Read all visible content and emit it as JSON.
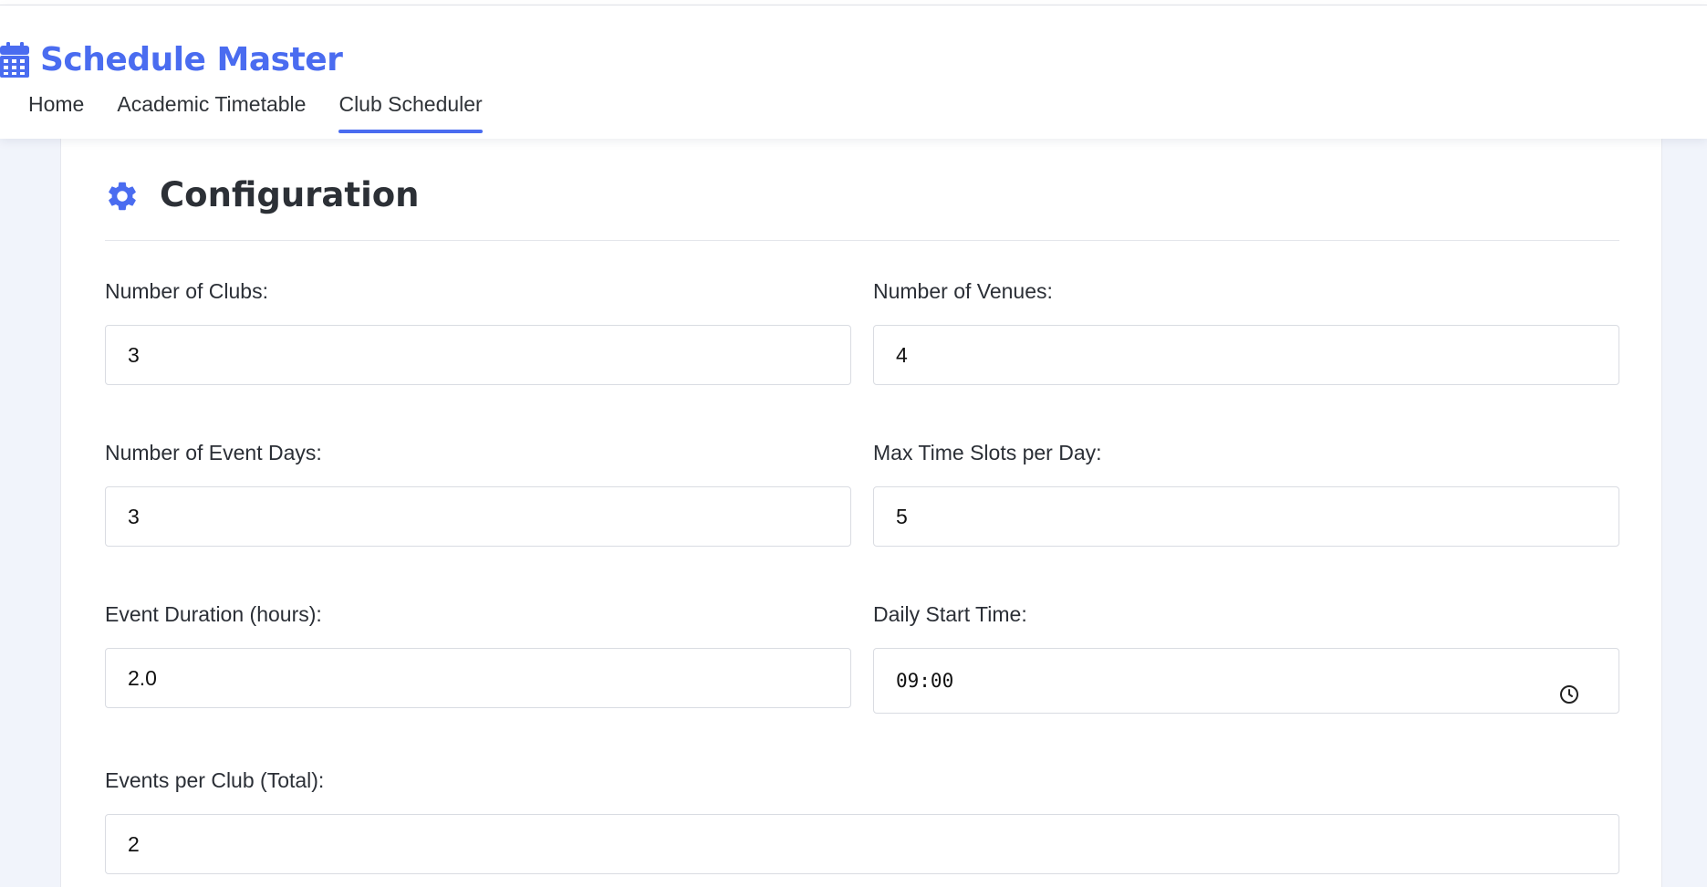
{
  "app": {
    "title": "Schedule Master",
    "brand_icon": "calendar-icon",
    "accent_color": "#4a6cf0"
  },
  "nav": {
    "items": [
      {
        "label": "Home",
        "active": false
      },
      {
        "label": "Academic Timetable",
        "active": false
      },
      {
        "label": "Club Scheduler",
        "active": true
      }
    ]
  },
  "config": {
    "title": "Configuration",
    "icon": "gear-icon",
    "fields": {
      "clubs": {
        "label": "Number of Clubs:",
        "value": "3"
      },
      "venues": {
        "label": "Number of Venues:",
        "value": "4"
      },
      "event_days": {
        "label": "Number of Event Days:",
        "value": "3"
      },
      "max_slots": {
        "label": "Max Time Slots per Day:",
        "value": "5"
      },
      "duration": {
        "label": "Event Duration (hours):",
        "value": "2.0"
      },
      "start_time": {
        "label": "Daily Start Time:",
        "value": "09:00",
        "icon": "clock-icon"
      },
      "events_per_club": {
        "label": "Events per Club (Total):",
        "value": "2"
      }
    }
  }
}
